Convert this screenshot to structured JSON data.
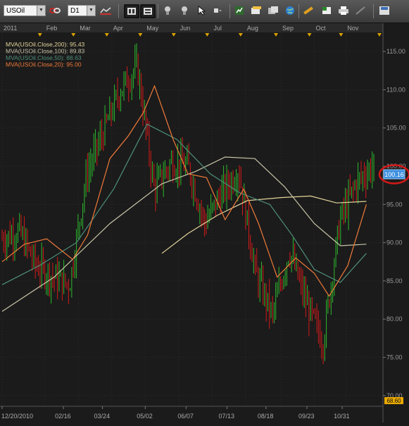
{
  "toolbar": {
    "symbol": "USOil",
    "timeframe": "D1",
    "icons": [
      "link-icon",
      "timeframe-icon",
      "chart-type-icon",
      "period-1-icon",
      "period-2-icon",
      "crosshair-icon",
      "pointer-icon",
      "arrow-cursor-icon",
      "shape-icon",
      "indicator-icon",
      "note-icon",
      "template-icon",
      "globe-icon",
      "ruler-icon",
      "excel-icon",
      "print-icon",
      "draw-icon",
      "save-icon"
    ]
  },
  "legend": [
    {
      "label": "MVA(USOil.Close,200)",
      "value": "95.43",
      "color": "#e3d49a"
    },
    {
      "label": "MVA(USOil.Close,100)",
      "value": "89.83",
      "color": "#c9c5a8"
    },
    {
      "label": "MVA(USOil.Close,50)",
      "value": "88.63",
      "color": "#4f8f7a"
    },
    {
      "label": "MVA(USOil.Close,20)",
      "value": "95.00",
      "color": "#f07a3a"
    }
  ],
  "months": [
    "2011",
    "Feb",
    "Mar",
    "Apr",
    "May",
    "Jun",
    "Jul",
    "Aug",
    "Sep",
    "Oct",
    "Nov"
  ],
  "dates": [
    "12/20/2010",
    "02/16",
    "03/24",
    "05/02",
    "06/07",
    "07/13",
    "08/18",
    "09/23",
    "10/31"
  ],
  "price_labels": [
    "115.00",
    "110.00",
    "105.00",
    "100.00",
    "95.00",
    "90.00",
    "85.00",
    "80.00",
    "75.00",
    "70.00"
  ],
  "current_price": "100.16",
  "bottom_price": "68.60",
  "chart_data": {
    "type": "line",
    "symbol": "USOil",
    "timeframe": "D1",
    "ylim": [
      68.6,
      117.5
    ],
    "last_price": 100.16,
    "close_points": [
      [
        "12/20/2010",
        90.5
      ],
      [
        "01/10",
        91.5
      ],
      [
        "01/25",
        87.0
      ],
      [
        "02/10",
        85.5
      ],
      [
        "02/16",
        84.5
      ],
      [
        "03/01",
        99.0
      ],
      [
        "03/24",
        104.5
      ],
      [
        "04/10",
        110.0
      ],
      [
        "05/02",
        113.0
      ],
      [
        "05/10",
        97.0
      ],
      [
        "05/20",
        100.5
      ],
      [
        "06/07",
        100.0
      ],
      [
        "06/20",
        92.5
      ],
      [
        "07/13",
        96.5
      ],
      [
        "07/25",
        99.5
      ],
      [
        "08/05",
        86.0
      ],
      [
        "08/18",
        80.5
      ],
      [
        "09/01",
        89.0
      ],
      [
        "09/23",
        82.0
      ],
      [
        "10/05",
        77.0
      ],
      [
        "10/31",
        93.0
      ],
      [
        "11/10",
        98.0
      ],
      [
        "11/16",
        100.16
      ]
    ],
    "series": [
      {
        "name": "MVA(USOil.Close,200)",
        "last": 95.43,
        "values": [
          [
            0.43,
            88.6
          ],
          [
            0.5,
            91.2
          ],
          [
            0.58,
            93.6
          ],
          [
            0.66,
            95.5
          ],
          [
            0.75,
            95.9
          ],
          [
            0.83,
            96.1
          ],
          [
            0.9,
            95.2
          ],
          [
            0.98,
            95.4
          ]
        ]
      },
      {
        "name": "MVA(USOil.Close,100)",
        "last": 89.83,
        "values": [
          [
            0.0,
            81.0
          ],
          [
            0.14,
            85.5
          ],
          [
            0.29,
            92.5
          ],
          [
            0.43,
            97.7
          ],
          [
            0.52,
            99.3
          ],
          [
            0.6,
            101.2
          ],
          [
            0.68,
            101.0
          ],
          [
            0.76,
            97.3
          ],
          [
            0.84,
            92.5
          ],
          [
            0.91,
            89.6
          ],
          [
            0.98,
            89.8
          ]
        ]
      },
      {
        "name": "MVA(USOil.Close,50)",
        "last": 88.63,
        "values": [
          [
            0.0,
            84.5
          ],
          [
            0.1,
            87.0
          ],
          [
            0.2,
            90.0
          ],
          [
            0.3,
            97.0
          ],
          [
            0.39,
            105.5
          ],
          [
            0.47,
            103.5
          ],
          [
            0.56,
            99.0
          ],
          [
            0.64,
            96.5
          ],
          [
            0.72,
            95.0
          ],
          [
            0.78,
            91.0
          ],
          [
            0.84,
            86.5
          ],
          [
            0.91,
            84.8
          ],
          [
            0.98,
            88.6
          ]
        ]
      },
      {
        "name": "MVA(USOil.Close,20)",
        "last": 95.0,
        "values": [
          [
            0.0,
            87.5
          ],
          [
            0.06,
            89.8
          ],
          [
            0.12,
            90.5
          ],
          [
            0.19,
            87.8
          ],
          [
            0.23,
            91.0
          ],
          [
            0.29,
            101.0
          ],
          [
            0.34,
            104.0
          ],
          [
            0.38,
            107.0
          ],
          [
            0.41,
            110.5
          ],
          [
            0.46,
            103.5
          ],
          [
            0.5,
            99.0
          ],
          [
            0.55,
            98.5
          ],
          [
            0.6,
            93.0
          ],
          [
            0.65,
            97.0
          ],
          [
            0.69,
            92.5
          ],
          [
            0.74,
            85.5
          ],
          [
            0.79,
            88.0
          ],
          [
            0.84,
            86.0
          ],
          [
            0.88,
            83.0
          ],
          [
            0.93,
            87.0
          ],
          [
            0.98,
            95.0
          ]
        ]
      }
    ]
  }
}
